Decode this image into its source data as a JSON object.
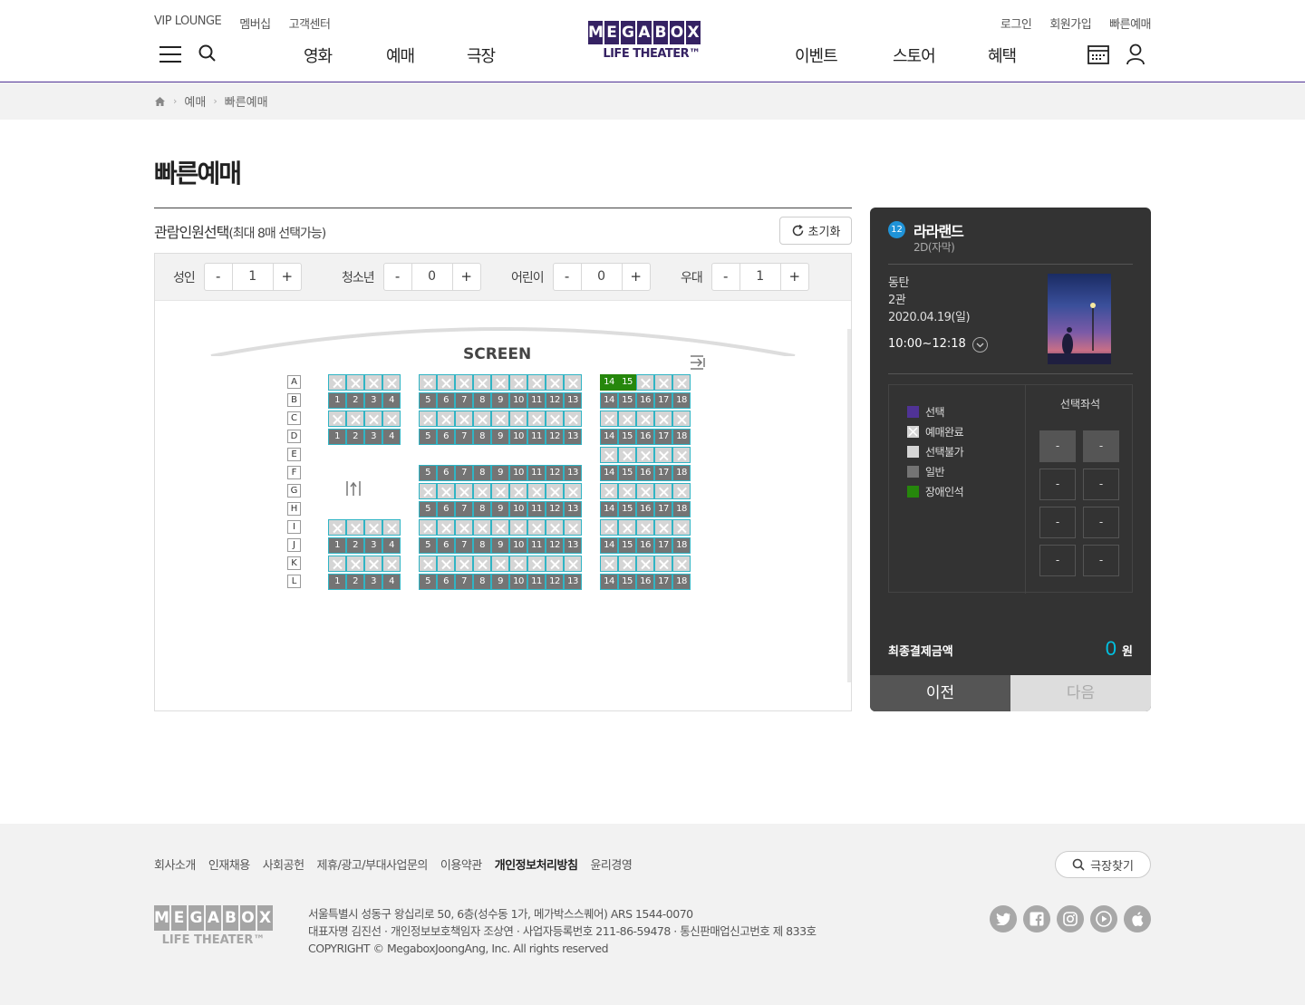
{
  "header": {
    "top_left": [
      "VIP LOUNGE",
      "멤버십",
      "고객센터"
    ],
    "top_right": [
      "로그인",
      "회원가입",
      "빠른예매"
    ],
    "logo_letters": [
      "M",
      "E",
      "G",
      "A",
      "B",
      "O",
      "X"
    ],
    "logo_tagline": "LIFE THEATER™",
    "nav_left": [
      "영화",
      "예매",
      "극장"
    ],
    "nav_right": [
      "이벤트",
      "스토어",
      "혜택"
    ]
  },
  "breadcrumb": [
    "예매",
    "빠른예매"
  ],
  "page_title": "빠른예매",
  "section": {
    "title": "관람인원선택",
    "note": "(최대 8매 선택가능)",
    "reset_label": "초기화"
  },
  "counters": [
    {
      "label": "성인",
      "value": "1"
    },
    {
      "label": "청소년",
      "value": "0"
    },
    {
      "label": "어린이",
      "value": "0"
    },
    {
      "label": "우대",
      "value": "1"
    }
  ],
  "stepper": {
    "minus": "-",
    "plus": "+"
  },
  "screen_label": "SCREEN",
  "seatmap": {
    "rows": [
      "A",
      "B",
      "C",
      "D",
      "E",
      "F",
      "G",
      "H",
      "I",
      "J",
      "K",
      "L"
    ],
    "blocks": [
      {
        "name": "left",
        "cols": [
          "1",
          "2",
          "3",
          "4"
        ]
      },
      {
        "name": "center",
        "cols": [
          "5",
          "6",
          "7",
          "8",
          "9",
          "10",
          "11",
          "12",
          "13"
        ]
      },
      {
        "name": "right",
        "cols": [
          "14",
          "15",
          "16",
          "17",
          "18"
        ]
      }
    ],
    "row_status": {
      "A": [
        "x",
        "x",
        "x"
      ],
      "B": [
        "n",
        "n",
        "n"
      ],
      "C": [
        "x",
        "x",
        "x"
      ],
      "D": [
        "n",
        "n",
        "n"
      ],
      "E": [
        "",
        "",
        "x"
      ],
      "F": [
        "",
        "n",
        "n"
      ],
      "G": [
        "",
        "x",
        "x"
      ],
      "H": [
        "",
        "n",
        "n"
      ],
      "I": [
        "x",
        "x",
        "x"
      ],
      "J": [
        "n",
        "n",
        "n"
      ],
      "K": [
        "x",
        "x",
        "x"
      ],
      "L": [
        "n",
        "n",
        "n"
      ]
    },
    "handicap_row_A": [
      "14",
      "15"
    ]
  },
  "booking": {
    "age_rating": "12",
    "movie_title": "라라랜드",
    "format": "2D(자막)",
    "theater": "동탄",
    "hall": "2관",
    "date": "2020.04.19(일)",
    "time": "10:00~12:18",
    "legend": [
      {
        "label": "선택",
        "color": "#503396"
      },
      {
        "label": "예매완료",
        "color": "#d5d5d5"
      },
      {
        "label": "선택불가",
        "color": "#d5d5d5"
      },
      {
        "label": "일반",
        "color": "#747474"
      },
      {
        "label": "장애인석",
        "color": "#26870c"
      }
    ],
    "selected_seats_title": "선택좌석",
    "selected_seats": [
      "-",
      "-",
      "-",
      "-",
      "-",
      "-",
      "-",
      "-"
    ],
    "total_label": "최종결제금액",
    "total_amount": "0",
    "currency": "원",
    "prev_label": "이전",
    "next_label": "다음"
  },
  "footer": {
    "links": [
      "회사소개",
      "인재채용",
      "사회공헌",
      "제휴/광고/부대사업문의",
      "이용약관",
      "개인정보처리방침",
      "윤리경영"
    ],
    "find_theater": "극장찾기",
    "address": "서울특별시 성동구 왕십리로 50, 6층(성수동 1가, 메가박스스퀘어) ARS 1544-0070",
    "representative": "대표자명 김진선 · 개인정보보호책임자 조상연 · 사업자등록번호 211-86-59478 · 통신판매업신고번호 제 833호",
    "copyright": "COPYRIGHT © MegaboxJoongAng, Inc. All rights reserved"
  }
}
